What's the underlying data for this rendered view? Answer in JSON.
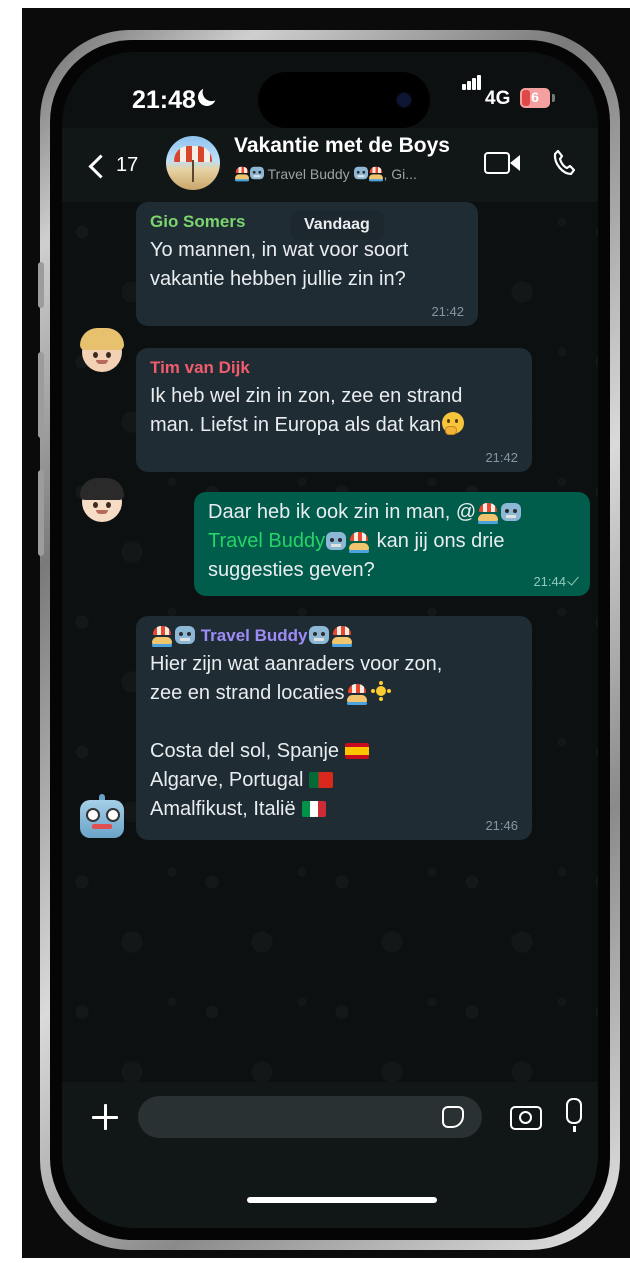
{
  "status_bar": {
    "time": "21:48",
    "network": "4G",
    "battery": "6",
    "icons": [
      "moon-icon",
      "signal-icon",
      "battery-icon"
    ]
  },
  "header": {
    "back_count": "17",
    "group_name": "Vakantie met de Boys",
    "members_text": "Travel Buddy",
    "members_suffix": ", Gi...",
    "icons": [
      "back-chevron-icon",
      "video-call-icon",
      "phone-call-icon"
    ]
  },
  "date_chip": "Vandaag",
  "messages": [
    {
      "sender": "Gio Somers",
      "sender_color": "#7bd46f",
      "lines": [
        "Yo mannen, in wat voor soort",
        "vakantie hebben jullie zin in?"
      ],
      "time": "21:42",
      "direction": "incoming"
    },
    {
      "sender": "Tim van Dijk",
      "sender_color": "#f15c6d",
      "lines": [
        "Ik heb wel zin in zon, zee en strand",
        "man. Liefst in Europa als dat kan"
      ],
      "time": "21:42",
      "direction": "incoming"
    },
    {
      "direction": "outgoing",
      "line1": "Daar heb ik ook zin in man, @",
      "mention": "Travel Buddy",
      "line2_rest": " kan jij ons drie",
      "line3": "suggesties geven?",
      "time": "21:44"
    },
    {
      "sender": "Travel Buddy",
      "sender_color": "#9c8cf8",
      "intro_line1": "Hier zijn wat aanraders voor zon,",
      "intro_line2": "zee en strand locaties",
      "destinations": [
        "Costa del sol, Spanje",
        "Algarve, Portugal",
        "Amalfikust, Italië"
      ],
      "time": "21:46",
      "direction": "incoming"
    }
  ],
  "input_bar": {
    "placeholder": "",
    "icons": [
      "plus-icon",
      "sticker-icon",
      "camera-icon",
      "microphone-icon"
    ]
  },
  "colors": {
    "background": "#0c1011",
    "incoming_bubble": "#202c33",
    "outgoing_bubble": "#005c4b",
    "mention": "#25d366"
  }
}
